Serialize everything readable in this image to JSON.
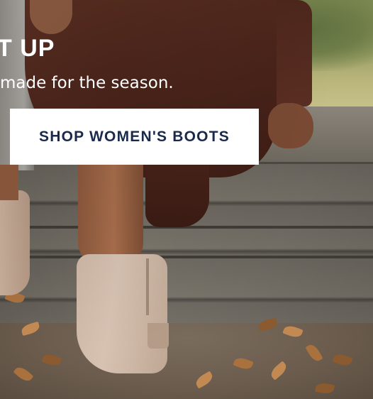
{
  "hero": {
    "headline": "T UP",
    "subtext": "made for the season.",
    "cta_label": "SHOP WOMEN'S BOOTS"
  },
  "colors": {
    "cta_background": "#ffffff",
    "cta_text": "#1b2a4a",
    "headline_text": "#ffffff"
  },
  "image": {
    "subject": "hero-photo"
  }
}
